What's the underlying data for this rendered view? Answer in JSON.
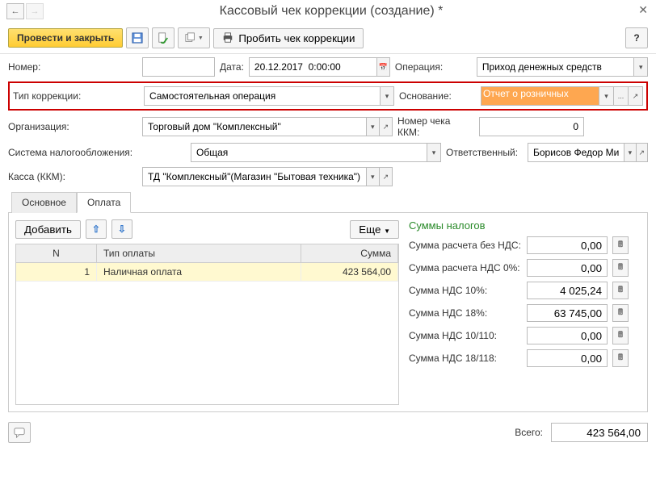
{
  "title": "Кассовый чек коррекции (создание) *",
  "toolbar": {
    "post_close": "Провести и закрыть",
    "print_correction": "Пробить чек коррекции"
  },
  "labels": {
    "number": "Номер:",
    "date": "Дата:",
    "operation": "Операция:",
    "correction_type": "Тип коррекции:",
    "basis": "Основание:",
    "organization": "Организация:",
    "receipt_number": "Номер чека ККМ:",
    "tax_system": "Система налогообложения:",
    "responsible": "Ответственный:",
    "kkm": "Касса (ККМ):",
    "add": "Добавить",
    "more": "Еще",
    "total": "Всего:"
  },
  "values": {
    "number": "",
    "date": "20.12.2017  0:00:00",
    "operation": "Приход денежных средств",
    "correction_type": "Самостоятельная операция",
    "basis": "Отчет о розничных",
    "organization": "Торговый дом \"Комплексный\"",
    "receipt_number": "0",
    "tax_system": "Общая",
    "responsible": "Борисов Федор Михайлович",
    "kkm": "ТД \"Комплексный\"(Магазин \"Бытовая техника\")",
    "total": "423 564,00"
  },
  "tabs": {
    "main": "Основное",
    "payment": "Оплата"
  },
  "table": {
    "cols": {
      "n": "N",
      "type": "Тип оплаты",
      "sum": "Сумма"
    },
    "rows": [
      {
        "n": "1",
        "type": "Наличная оплата",
        "sum": "423 564,00"
      }
    ]
  },
  "taxes": {
    "title": "Суммы налогов",
    "rows": [
      {
        "label": "Сумма расчета без НДС:",
        "value": "0,00"
      },
      {
        "label": "Сумма расчета НДС 0%:",
        "value": "0,00"
      },
      {
        "label": "Сумма НДС 10%:",
        "value": "4 025,24"
      },
      {
        "label": "Сумма НДС 18%:",
        "value": "63 745,00"
      },
      {
        "label": "Сумма НДС 10/110:",
        "value": "0,00"
      },
      {
        "label": "Сумма НДС 18/118:",
        "value": "0,00"
      }
    ]
  }
}
